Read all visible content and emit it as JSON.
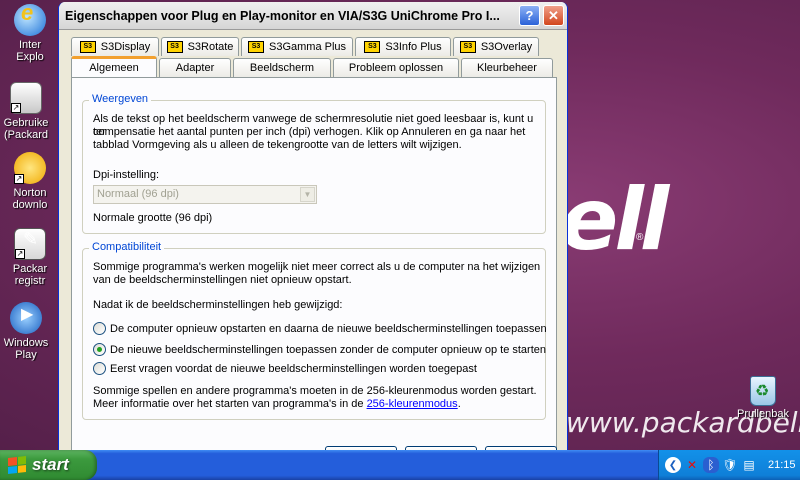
{
  "desktop": {
    "brand_big": "ell",
    "brand_url": "www.packardbell.nl",
    "icons": [
      {
        "label1": "Inter",
        "label2": "Explo"
      },
      {
        "label1": "Gebruike",
        "label2": "(Packard"
      },
      {
        "label1": "Norton",
        "label2": "downlo"
      },
      {
        "label1": "Packar",
        "label2": "registr"
      },
      {
        "label1": "Windows",
        "label2": "Play"
      }
    ],
    "recycle_label": "Prullenbak"
  },
  "window": {
    "title": "Eigenschappen voor Plug en Play-monitor en VIA/S3G UniChrome Pro I...",
    "help_glyph": "?",
    "close_glyph": "✕"
  },
  "tabs_row1": [
    "S3Display",
    "S3Rotate",
    "S3Gamma Plus",
    "S3Info Plus",
    "S3Overlay"
  ],
  "tabs_row1_badge": "S3",
  "tabs_row2": [
    "Algemeen",
    "Adapter",
    "Beeldscherm",
    "Probleem oplossen",
    "Kleurbeheer"
  ],
  "weergeven": {
    "legend": "Weergeven",
    "line1": "Als de tekst op het beeldscherm vanwege de schermresolutie niet goed leesbaar is, kunt u ter",
    "line2": "compensatie het aantal punten per inch (dpi) verhogen. Klik op Annuleren en ga naar het",
    "line3": "tabblad Vormgeving als u alleen de tekengrootte van de letters wilt wijzigen.",
    "dpi_label": "Dpi-instelling:",
    "dpi_value": "Normaal (96 dpi)",
    "size_text": "Normale grootte (96 dpi)"
  },
  "compat": {
    "legend": "Compatibiliteit",
    "line1": "Sommige programma's werken mogelijk niet meer correct als u de computer na het wijzigen",
    "line2": "van de beeldscherminstellingen niet opnieuw opstart.",
    "question": "Nadat ik de beeldscherminstellingen heb gewijzigd:",
    "options": [
      "De computer opnieuw opstarten en daarna de nieuwe beeldscherminstellingen toepassen",
      "De nieuwe beeldscherminstellingen toepassen zonder de computer opnieuw op te starten",
      "Eerst vragen voordat de nieuwe beeldscherminstellingen worden toegepast"
    ],
    "selected_index": 1,
    "note1": "Sommige spellen en andere programma's moeten in de 256-kleurenmodus worden gestart.",
    "note2_prefix": "Meer informatie over het starten van programma's in de ",
    "note2_link": "256-kleurenmodus",
    "note2_suffix": "."
  },
  "taskbar": {
    "start_label": "start",
    "clock": "21:15"
  }
}
